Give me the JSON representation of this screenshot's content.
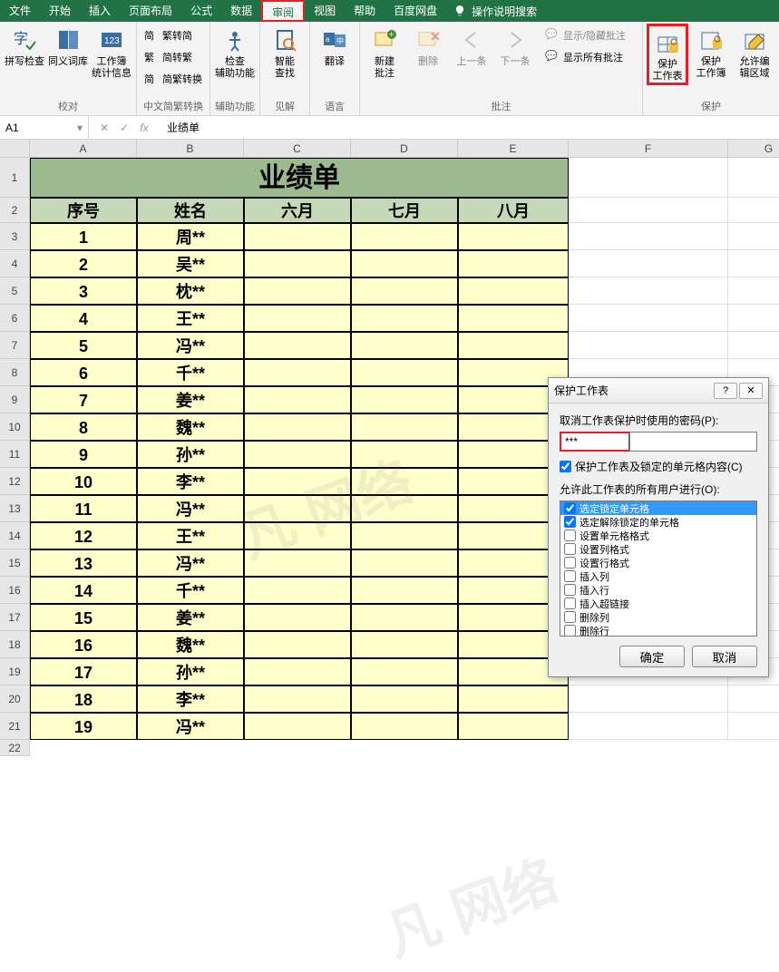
{
  "tabs": [
    "文件",
    "开始",
    "插入",
    "页面布局",
    "公式",
    "数据",
    "审阅",
    "视图",
    "帮助",
    "百度网盘"
  ],
  "tabs_active_index": 6,
  "tell_me": "操作说明搜索",
  "ribbon": {
    "group1": {
      "label": "校对",
      "btns": [
        "拼写检查",
        "同义词库",
        "工作簿\n统计信息"
      ]
    },
    "group2": {
      "label": "中文简繁转换",
      "btns": [
        "繁转简",
        "简转繁",
        "简繁转换"
      ]
    },
    "group3": {
      "label": "辅助功能",
      "btn": "检查\n辅助功能"
    },
    "group4": {
      "label": "见解",
      "btn": "智能\n查找"
    },
    "group5": {
      "label": "语言",
      "btn": "翻译"
    },
    "group6": {
      "label": "批注",
      "btns": [
        "新建\n批注",
        "删除",
        "上一条",
        "下一条"
      ],
      "side": [
        "显示/隐藏批注",
        "显示所有批注"
      ]
    },
    "group7": {
      "label": "保护",
      "btns": [
        "保护\n工作表",
        "保护\n工作簿",
        "允许编\n辑区域"
      ]
    }
  },
  "namebox": "A1",
  "formula": "业绩单",
  "columns": [
    "A",
    "B",
    "C",
    "D",
    "E",
    "F",
    "G"
  ],
  "sheet": {
    "title": "业绩单",
    "headers": [
      "序号",
      "姓名",
      "六月",
      "七月",
      "八月"
    ],
    "rows": [
      [
        "1",
        "周**",
        "",
        "",
        ""
      ],
      [
        "2",
        "吴**",
        "",
        "",
        ""
      ],
      [
        "3",
        "枕**",
        "",
        "",
        ""
      ],
      [
        "4",
        "王**",
        "",
        "",
        ""
      ],
      [
        "5",
        "冯**",
        "",
        "",
        ""
      ],
      [
        "6",
        "千**",
        "",
        "",
        ""
      ],
      [
        "7",
        "姜**",
        "",
        "",
        ""
      ],
      [
        "8",
        "魏**",
        "",
        "",
        ""
      ],
      [
        "9",
        "孙**",
        "",
        "",
        ""
      ],
      [
        "10",
        "李**",
        "",
        "",
        ""
      ],
      [
        "11",
        "冯**",
        "",
        "",
        ""
      ],
      [
        "12",
        "王**",
        "",
        "",
        ""
      ],
      [
        "13",
        "冯**",
        "",
        "",
        ""
      ],
      [
        "14",
        "千**",
        "",
        "",
        ""
      ],
      [
        "15",
        "姜**",
        "",
        "",
        ""
      ],
      [
        "16",
        "魏**",
        "",
        "",
        ""
      ],
      [
        "17",
        "孙**",
        "",
        "",
        ""
      ],
      [
        "18",
        "李**",
        "",
        "",
        ""
      ],
      [
        "19",
        "冯**",
        "",
        "",
        ""
      ]
    ]
  },
  "dialog": {
    "title": "保护工作表",
    "pwd_label": "取消工作表保护时使用的密码(P):",
    "pwd_value": "***",
    "protect_check": "保护工作表及锁定的单元格内容(C)",
    "list_label": "允许此工作表的所有用户进行(O):",
    "items": [
      {
        "label": "选定锁定单元格",
        "checked": true,
        "sel": true
      },
      {
        "label": "选定解除锁定的单元格",
        "checked": true
      },
      {
        "label": "设置单元格格式",
        "checked": false
      },
      {
        "label": "设置列格式",
        "checked": false
      },
      {
        "label": "设置行格式",
        "checked": false
      },
      {
        "label": "插入列",
        "checked": false
      },
      {
        "label": "插入行",
        "checked": false
      },
      {
        "label": "插入超链接",
        "checked": false
      },
      {
        "label": "删除列",
        "checked": false
      },
      {
        "label": "删除行",
        "checked": false
      }
    ],
    "ok": "确定",
    "cancel": "取消"
  },
  "watermark": "凡 网络"
}
